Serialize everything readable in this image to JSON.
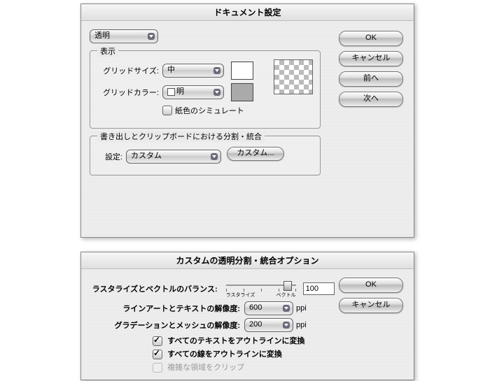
{
  "dialog1": {
    "title": "ドキュメント設定",
    "section_select": "透明",
    "display": {
      "legend": "表示",
      "grid_size_label": "グリッドサイズ:",
      "grid_size_value": "中",
      "grid_color_label": "グリッドカラー:",
      "grid_color_value": "明",
      "simulate_paper_label": "紙色のシミュレート"
    },
    "divide": {
      "legend": "書き出しとクリップボードにおける分割・統合",
      "preset_label": "設定:",
      "preset_value": "カスタム",
      "custom_btn": "カスタム..."
    },
    "buttons": {
      "ok": "OK",
      "cancel": "キャンセル",
      "prev": "前へ",
      "next": "次へ"
    }
  },
  "dialog2": {
    "title": "カスタムの透明分割・統合オプション",
    "balance_label": "ラスタライズとベクトルのバランス:",
    "balance_min": "ラスタライズ",
    "balance_max": "ベクトル",
    "balance_value": "100",
    "lineart_label": "ラインアートとテキストの解像度:",
    "lineart_value": "600",
    "gradient_label": "グラデーションとメッシュの解像度:",
    "gradient_value": "200",
    "unit_ppi": "ppi",
    "cb_text_outline": "すべてのテキストをアウトラインに変換",
    "cb_stroke_outline": "すべての線をアウトラインに変換",
    "cb_clip_complex": "複雑な領域をクリップ",
    "buttons": {
      "ok": "OK",
      "cancel": "キャンセル"
    }
  }
}
